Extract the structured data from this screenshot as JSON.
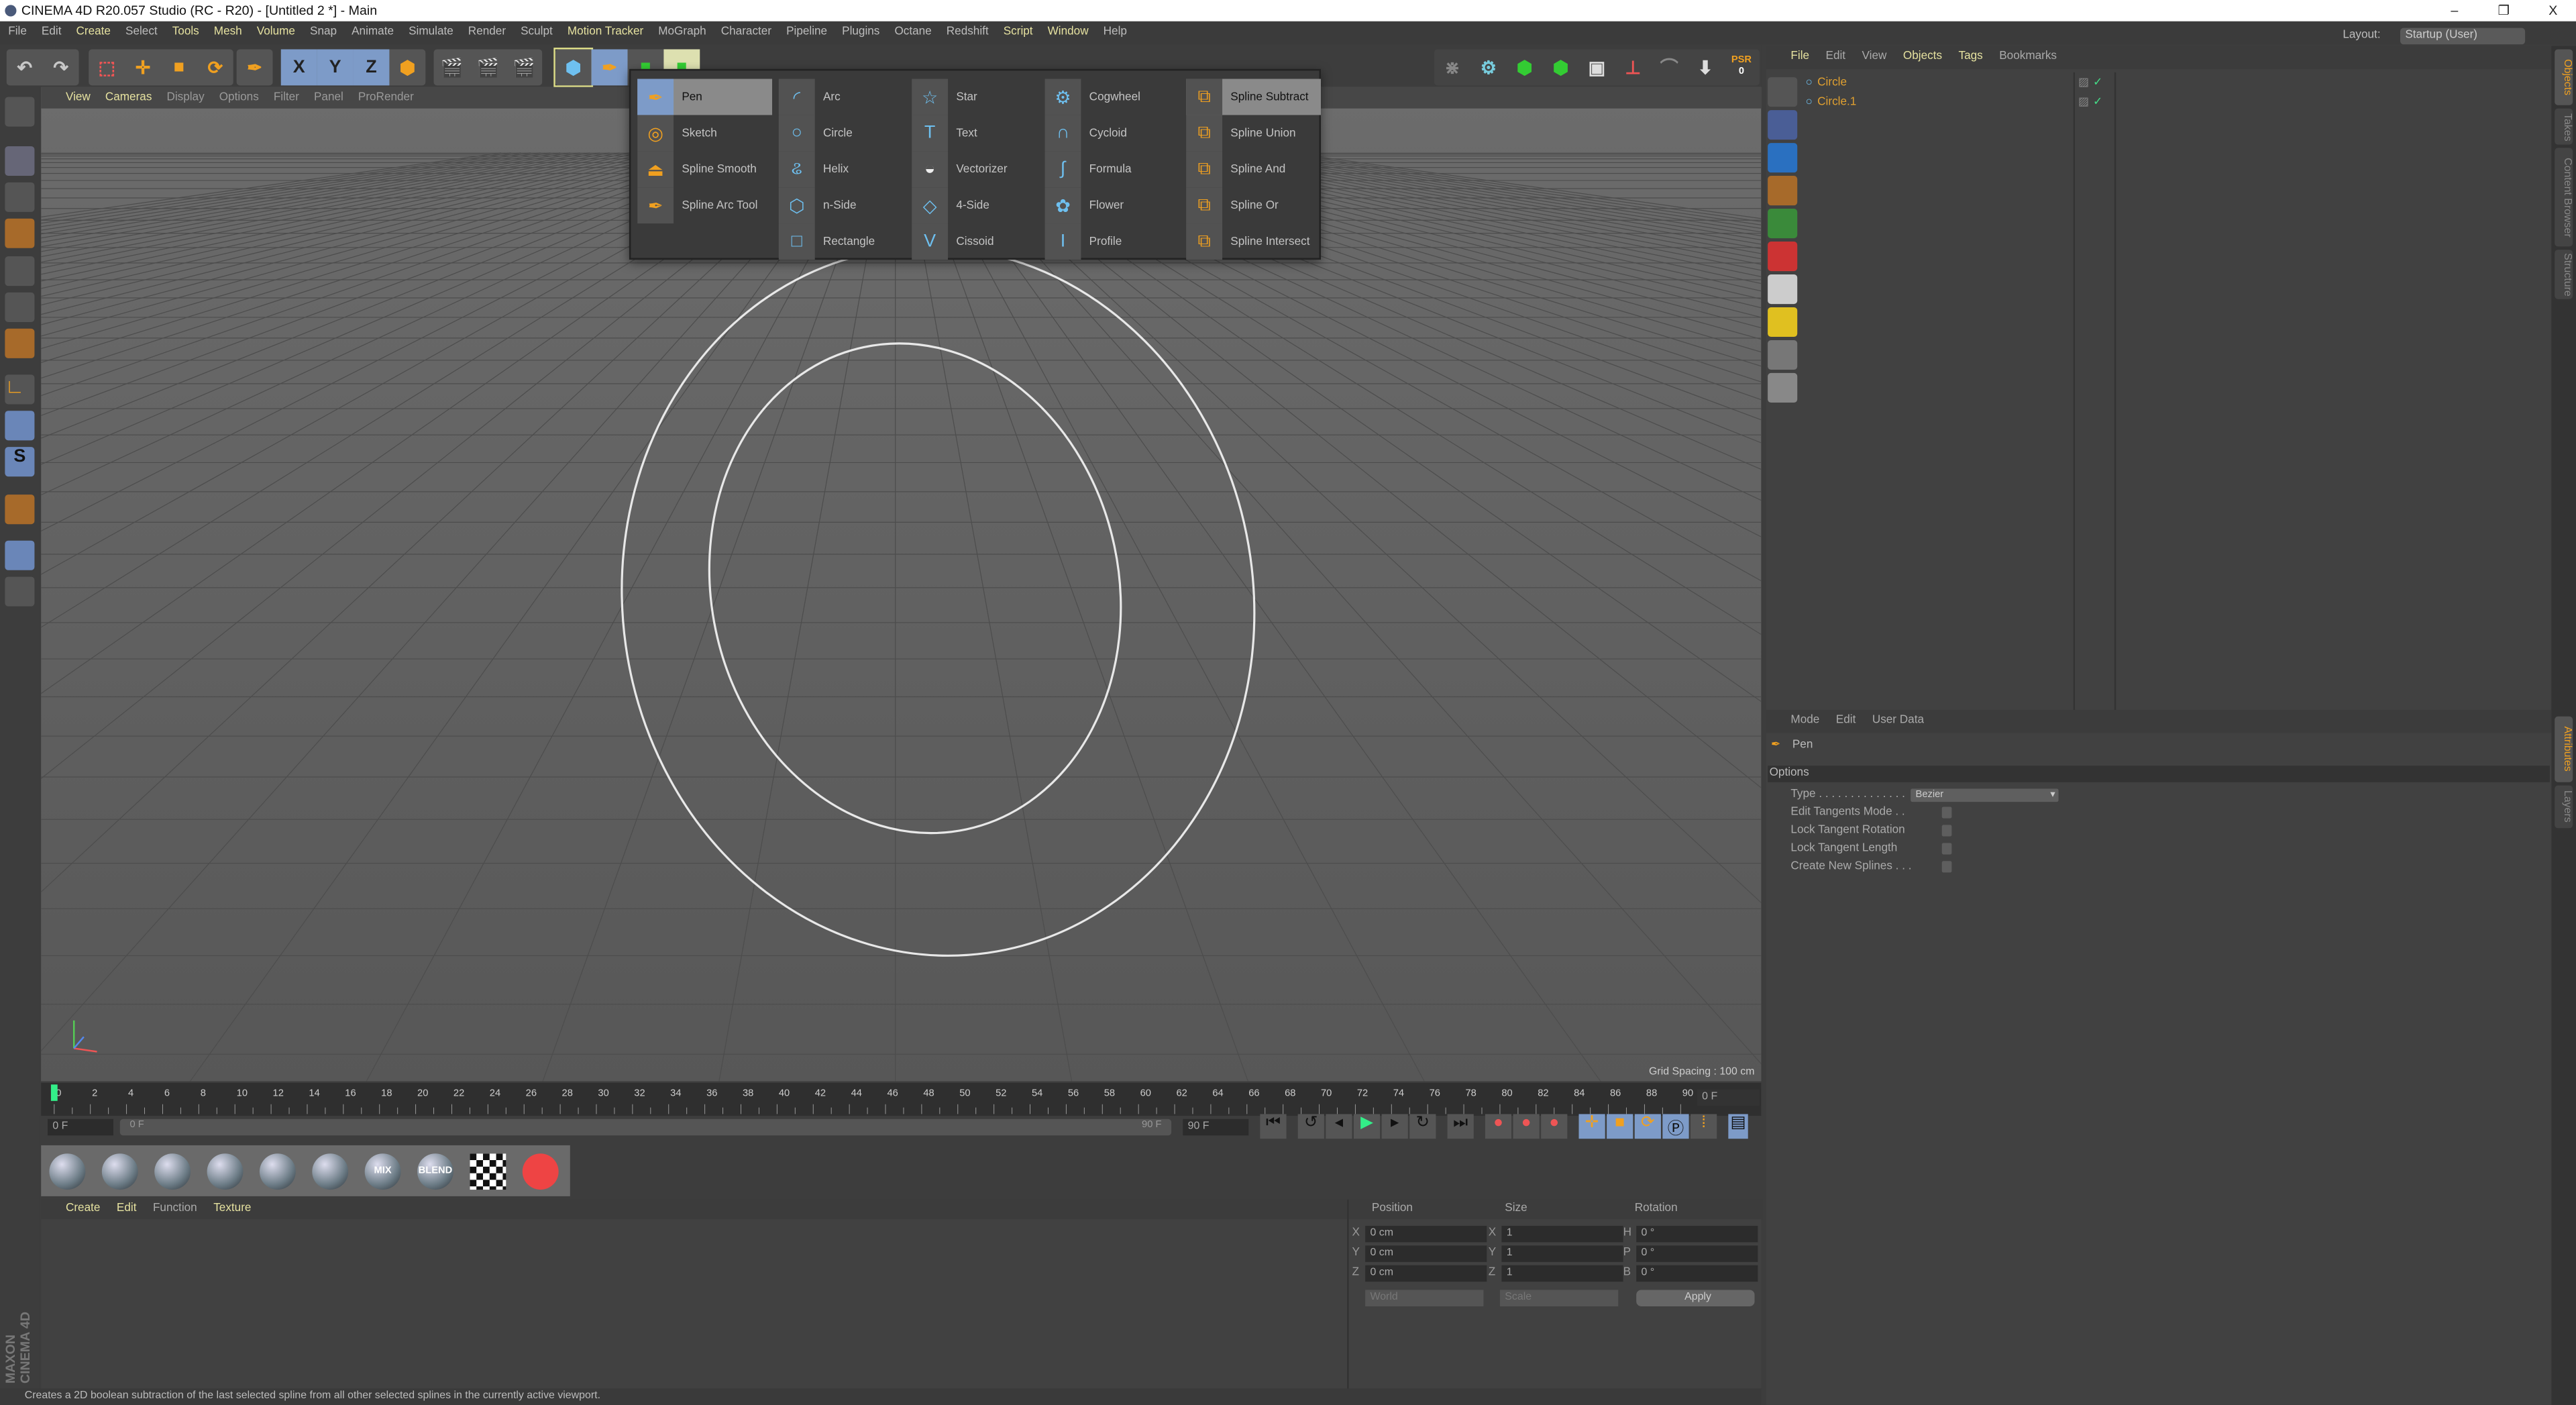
{
  "window": {
    "title": "CINEMA 4D R20.057 Studio (RC - R20) - [Untitled 2 *] - Main",
    "minimize": "–",
    "restore": "❐",
    "close": "X"
  },
  "menubar": [
    {
      "label": "File"
    },
    {
      "label": "Edit"
    },
    {
      "label": "Create",
      "hl": true
    },
    {
      "label": "Select"
    },
    {
      "label": "Tools",
      "hl": true
    },
    {
      "label": "Mesh",
      "hl": true
    },
    {
      "label": "Volume",
      "hl": true
    },
    {
      "label": "Snap"
    },
    {
      "label": "Animate"
    },
    {
      "label": "Simulate"
    },
    {
      "label": "Render"
    },
    {
      "label": "Sculpt"
    },
    {
      "label": "Motion Tracker",
      "hl": true
    },
    {
      "label": "MoGraph"
    },
    {
      "label": "Character"
    },
    {
      "label": "Pipeline"
    },
    {
      "label": "Plugins"
    },
    {
      "label": "Octane"
    },
    {
      "label": "Redshift"
    },
    {
      "label": "Script",
      "hl": true
    },
    {
      "label": "Window",
      "hl": true
    },
    {
      "label": "Help"
    }
  ],
  "layout": {
    "label": "Layout:",
    "value": "Startup (User)"
  },
  "toolbar": {
    "axis_x": "X",
    "axis_y": "Y",
    "axis_z": "Z",
    "psr": "PSR",
    "psr_value": "0"
  },
  "viewport": {
    "menu": [
      {
        "label": "View",
        "hl": true
      },
      {
        "label": "Cameras",
        "hl": true
      },
      {
        "label": "Display"
      },
      {
        "label": "Options"
      },
      {
        "label": "Filter"
      },
      {
        "label": "Panel"
      },
      {
        "label": "ProRender"
      }
    ],
    "grid_spacing": "Grid Spacing : 100 cm"
  },
  "spline_menu": {
    "columns": [
      [
        {
          "label": "Pen",
          "icon": "pen-icon",
          "sel": true,
          "glyph": "✒",
          "color": "#f0a020"
        },
        {
          "label": "Sketch",
          "icon": "sketch-icon",
          "glyph": "◎",
          "color": "#f0a020"
        },
        {
          "label": "Spline Smooth",
          "icon": "spline-smooth-icon",
          "glyph": "⏏",
          "color": "#f0a020"
        },
        {
          "label": "Spline Arc Tool",
          "icon": "spline-arc-tool-icon",
          "glyph": "✒",
          "color": "#f0a020"
        }
      ],
      [
        {
          "label": "Arc",
          "icon": "arc-icon",
          "glyph": "◜",
          "color": "#6ec0f0"
        },
        {
          "label": "Circle",
          "icon": "circle-icon",
          "glyph": "○",
          "color": "#6ec0f0"
        },
        {
          "label": "Helix",
          "icon": "helix-icon",
          "glyph": "ଌ",
          "color": "#6ec0f0"
        },
        {
          "label": "n-Side",
          "icon": "n-side-icon",
          "glyph": "⬡",
          "color": "#6ec0f0"
        },
        {
          "label": "Rectangle",
          "icon": "rectangle-icon",
          "glyph": "□",
          "color": "#6ec0f0"
        }
      ],
      [
        {
          "label": "Star",
          "icon": "star-icon",
          "glyph": "☆",
          "color": "#6ec0f0"
        },
        {
          "label": "Text",
          "icon": "text-icon",
          "glyph": "T",
          "color": "#6ec0f0"
        },
        {
          "label": "Vectorizer",
          "icon": "vectorizer-icon",
          "glyph": "◒",
          "color": "#eeeeee"
        },
        {
          "label": "4-Side",
          "icon": "four-side-icon",
          "glyph": "◇",
          "color": "#6ec0f0"
        },
        {
          "label": "Cissoid",
          "icon": "cissoid-icon",
          "glyph": "V",
          "color": "#6ec0f0"
        }
      ],
      [
        {
          "label": "Cogwheel",
          "icon": "cogwheel-icon",
          "glyph": "⚙",
          "color": "#6ec0f0"
        },
        {
          "label": "Cycloid",
          "icon": "cycloid-icon",
          "glyph": "∩",
          "color": "#6ec0f0"
        },
        {
          "label": "Formula",
          "icon": "formula-icon",
          "glyph": "∫",
          "color": "#6ec0f0"
        },
        {
          "label": "Flower",
          "icon": "flower-icon",
          "glyph": "✿",
          "color": "#6ec0f0"
        },
        {
          "label": "Profile",
          "icon": "profile-icon",
          "glyph": "I",
          "color": "#6ec0f0"
        }
      ],
      [
        {
          "label": "Spline Subtract",
          "icon": "spline-subtract-icon",
          "sel": true,
          "glyph": "⧉",
          "color": "#f0a020"
        },
        {
          "label": "Spline Union",
          "icon": "spline-union-icon",
          "glyph": "⧉",
          "color": "#f0a020"
        },
        {
          "label": "Spline And",
          "icon": "spline-and-icon",
          "glyph": "⧉",
          "color": "#f0a020"
        },
        {
          "label": "Spline Or",
          "icon": "spline-or-icon",
          "glyph": "⧉",
          "color": "#f0a020"
        },
        {
          "label": "Spline Intersect",
          "icon": "spline-intersect-icon",
          "glyph": "⧉",
          "color": "#f0a020"
        }
      ]
    ]
  },
  "objects": {
    "menu": [
      {
        "label": "File",
        "hl": true
      },
      {
        "label": "Edit"
      },
      {
        "label": "View"
      },
      {
        "label": "Objects",
        "hl": true
      },
      {
        "label": "Tags",
        "hl": true
      },
      {
        "label": "Bookmarks"
      }
    ],
    "items": [
      {
        "name": "Circle"
      },
      {
        "name": "Circle.1"
      }
    ]
  },
  "side_tabs": {
    "objects": "Objects",
    "takes": "Takes",
    "content_browser": "Content Browser",
    "structure": "Structure",
    "attributes": "Attributes",
    "layers": "Layers"
  },
  "attributes": {
    "menu": [
      {
        "label": "Mode"
      },
      {
        "label": "Edit"
      },
      {
        "label": "User Data"
      }
    ],
    "tool": "Pen",
    "section": "Options",
    "type_label": "Type . . . . . . . . . . . . . .",
    "type_value": "Bezier",
    "checkboxes": [
      {
        "label": "Edit Tangents Mode . .",
        "checked": false
      },
      {
        "label": "Lock Tangent Rotation",
        "checked": false
      },
      {
        "label": "Lock Tangent Length",
        "checked": false
      },
      {
        "label": "Create New Splines . . .",
        "checked": false
      }
    ]
  },
  "timeline": {
    "start": 0,
    "end": 90,
    "step": 2,
    "current": 0,
    "current_field": "0 F"
  },
  "range": {
    "start_field": "0 F",
    "slider_start": "0 F",
    "slider_end": "90 F",
    "end_field": "90 F"
  },
  "materials": {
    "menu": [
      {
        "label": "Create",
        "hl": true
      },
      {
        "label": "Edit",
        "hl": true
      },
      {
        "label": "Function"
      },
      {
        "label": "Texture",
        "hl": true
      }
    ],
    "presets": [
      "",
      "",
      "",
      "",
      "",
      "",
      "MIX",
      "BLEND",
      "",
      ""
    ]
  },
  "coordinates": {
    "position": "Position",
    "size": "Size",
    "rotation": "Rotation",
    "rows": [
      {
        "pl": "X",
        "pv": "0 cm",
        "sl": "X",
        "sv": "1",
        "rl": "H",
        "rv": "0 °"
      },
      {
        "pl": "Y",
        "pv": "0 cm",
        "sl": "Y",
        "sv": "1",
        "rl": "P",
        "rv": "0 °"
      },
      {
        "pl": "Z",
        "pv": "0 cm",
        "sl": "Z",
        "sv": "1",
        "rl": "B",
        "rv": "0 °"
      }
    ],
    "space": "World",
    "mode": "Scale",
    "apply": "Apply"
  },
  "branding": "MAXON CINEMA 4D",
  "status": "Creates a 2D boolean subtraction of the last selected spline from all other selected splines in the currently active viewport."
}
